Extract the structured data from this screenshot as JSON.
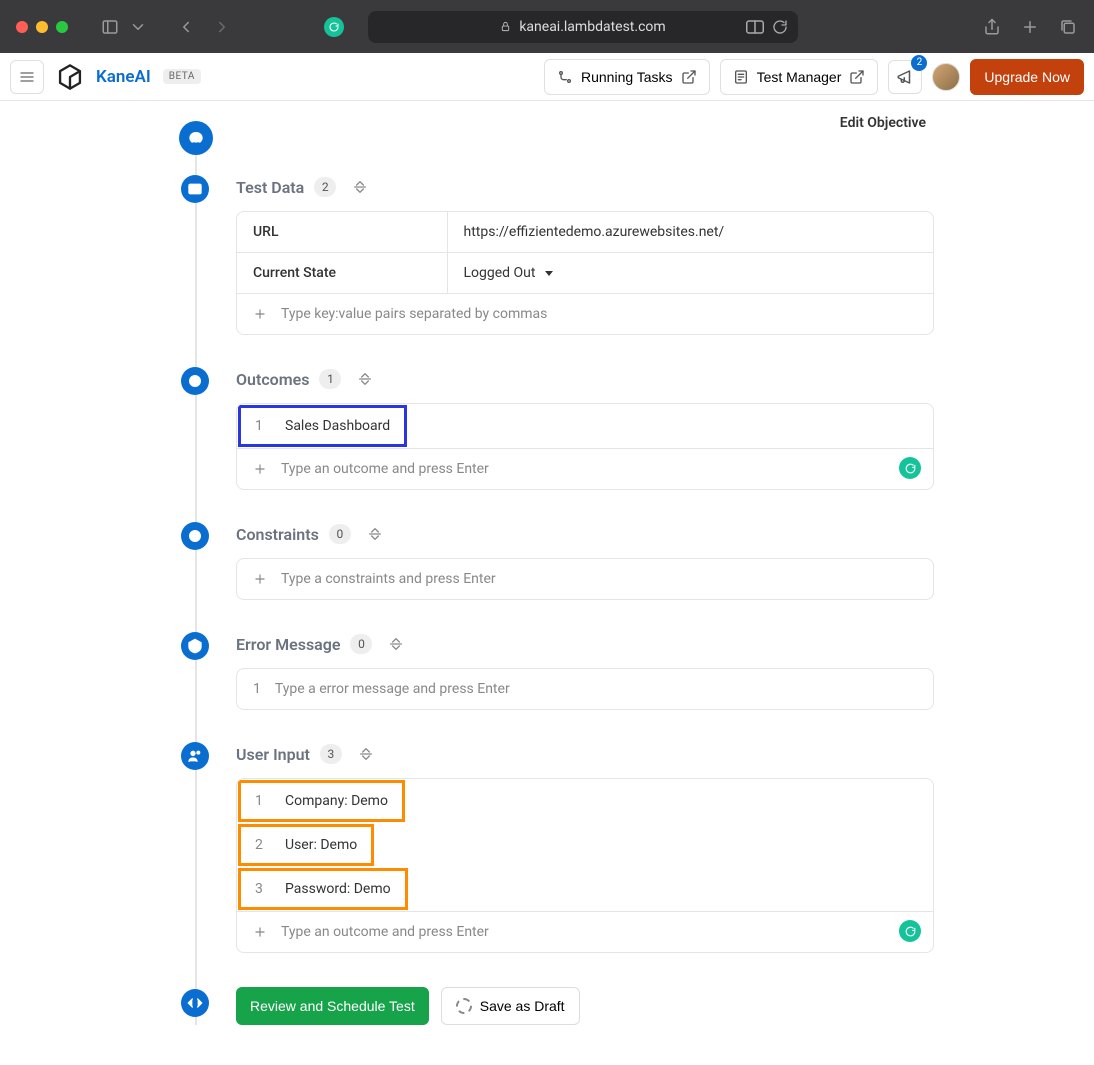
{
  "browser": {
    "url": "kaneai.lambdatest.com"
  },
  "topbar": {
    "brand": "KaneAI",
    "beta": "BETA",
    "running_tasks": "Running Tasks",
    "test_manager": "Test Manager",
    "notif_count": "2",
    "upgrade": "Upgrade Now"
  },
  "page": {
    "edit_objective": "Edit Objective"
  },
  "sections": {
    "test_data": {
      "title": "Test Data",
      "count": "2",
      "rows": {
        "url_label": "URL",
        "url_value": "https://effizientedemo.azurewebsites.net/",
        "state_label": "Current State",
        "state_value": "Logged Out"
      },
      "placeholder": "Type key:value pairs separated by commas"
    },
    "outcomes": {
      "title": "Outcomes",
      "count": "1",
      "items": [
        {
          "num": "1",
          "text": "Sales Dashboard"
        }
      ],
      "placeholder": "Type an outcome and press Enter"
    },
    "constraints": {
      "title": "Constraints",
      "count": "0",
      "placeholder": "Type a constraints and press Enter"
    },
    "error_message": {
      "title": "Error Message",
      "count": "0",
      "num": "1",
      "placeholder": "Type a error message and press Enter"
    },
    "user_input": {
      "title": "User Input",
      "count": "3",
      "items": [
        {
          "num": "1",
          "text": "Company: Demo"
        },
        {
          "num": "2",
          "text": "User: Demo"
        },
        {
          "num": "3",
          "text": "Password: Demo"
        }
      ],
      "placeholder": "Type an outcome and press Enter"
    }
  },
  "actions": {
    "review": "Review and Schedule Test",
    "draft": "Save as Draft"
  }
}
